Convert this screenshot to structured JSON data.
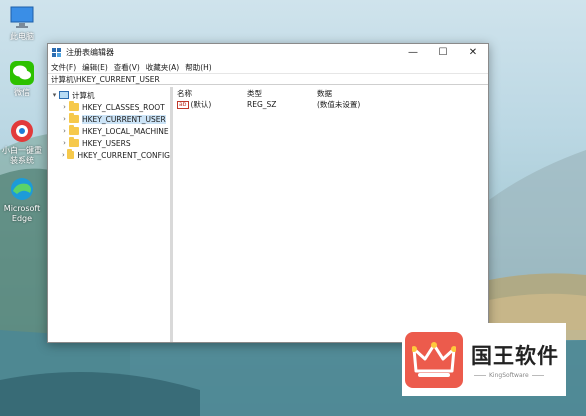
{
  "desktop": {
    "icons": [
      {
        "label": "此电脑",
        "icon": "monitor-icon"
      },
      {
        "label": "微信",
        "icon": "wechat-icon"
      },
      {
        "label": "小白一键重装系统",
        "icon": "reinstall-icon"
      },
      {
        "label": "Microsoft Edge",
        "icon": "edge-icon"
      }
    ]
  },
  "window": {
    "title": "注册表编辑器",
    "controls": {
      "minimize": "—",
      "maximize": "☐",
      "close": "✕"
    },
    "menu": [
      "文件(F)",
      "编辑(E)",
      "查看(V)",
      "收藏夹(A)",
      "帮助(H)"
    ],
    "address": "计算机\\HKEY_CURRENT_USER",
    "tree": {
      "root": "计算机",
      "items": [
        "HKEY_CLASSES_ROOT",
        "HKEY_CURRENT_USER",
        "HKEY_LOCAL_MACHINE",
        "HKEY_USERS",
        "HKEY_CURRENT_CONFIG"
      ],
      "selected": "HKEY_CURRENT_USER"
    },
    "list": {
      "headers": {
        "name": "名称",
        "type": "类型",
        "data": "数据"
      },
      "rows": [
        {
          "name": "(默认)",
          "type": "REG_SZ",
          "data": "(数值未设置)",
          "icon_text": "ab"
        }
      ]
    }
  },
  "watermark": {
    "brand": "国王软件",
    "sub": "KingSoftware",
    "accent": "#ec5b4c"
  }
}
